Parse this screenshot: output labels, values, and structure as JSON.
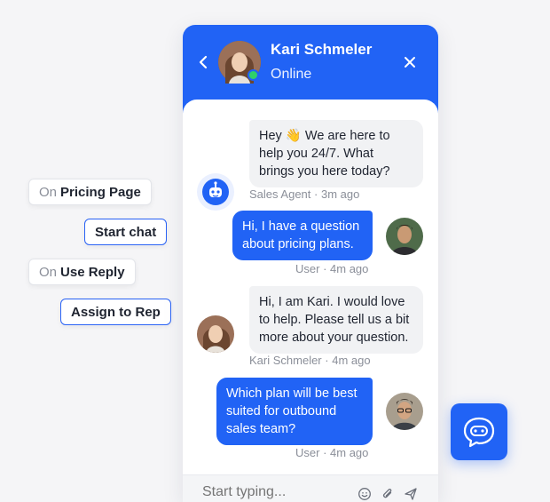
{
  "triggers": [
    {
      "prefix": "On",
      "label": "Pricing Page"
    },
    {
      "label": "Start chat"
    },
    {
      "prefix": "On",
      "label": "Use Reply"
    },
    {
      "label": "Assign to Rep"
    }
  ],
  "header": {
    "agent_name": "Kari Schmeler",
    "status": "Online",
    "back_icon": "chevron-left-icon",
    "close_icon": "close-icon"
  },
  "messages": [
    {
      "direction": "in",
      "text_lines": [
        "Hey 👋 We are here to",
        "help you 24/7. What",
        "brings you here today?"
      ],
      "sender": "Sales Agent",
      "time": "3m ago",
      "avatar": "bot"
    },
    {
      "direction": "out",
      "text_lines": [
        "Hi, I have a question",
        "about pricing plans."
      ],
      "sender": "User",
      "time": "4m ago",
      "avatar": "user"
    },
    {
      "direction": "in",
      "text_lines": [
        "Hi, I am Kari. I would love",
        "to help. Please tell us a bit",
        "more about your question."
      ],
      "sender": "Kari Schmeler",
      "time": "4m ago",
      "avatar": "agent"
    },
    {
      "direction": "out",
      "text_lines": [
        "Which plan will be best",
        "suited for outbound",
        "sales team?"
      ],
      "sender": "User",
      "time": "4m ago",
      "avatar": "user2"
    }
  ],
  "composer": {
    "placeholder": "Start typing...",
    "icons": [
      "emoji-icon",
      "attachment-icon",
      "send-icon"
    ]
  },
  "colors": {
    "accent": "#2163f5",
    "online": "#2fd06b",
    "incoming_bubble": "#f1f2f4",
    "background": "#f5f5f7"
  },
  "launcher": {
    "icon": "chat-bot-icon"
  }
}
